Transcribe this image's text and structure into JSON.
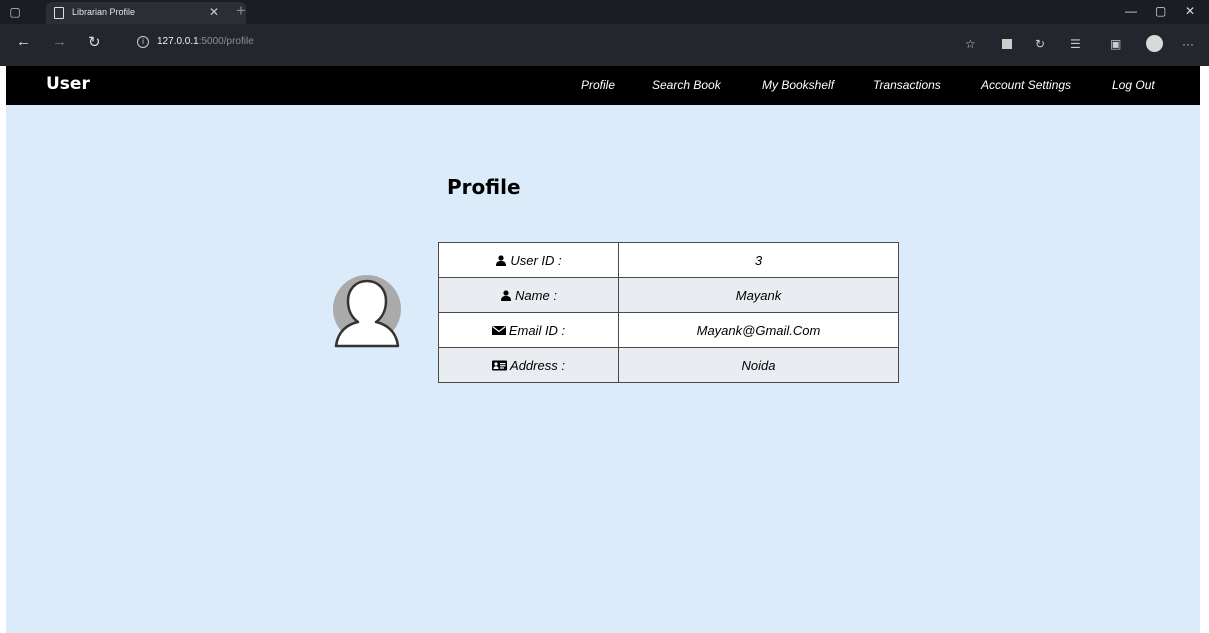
{
  "browser": {
    "tab_title": "Librarian Profile",
    "url_host": "127.0.0.1",
    "url_rest": ":5000/profile"
  },
  "navbar": {
    "brand": "User",
    "links": [
      "Profile",
      "Search Book",
      "My Bookshelf",
      "Transactions",
      "Account Settings",
      "Log Out"
    ]
  },
  "main": {
    "title": "Profile",
    "rows": [
      {
        "icon": "user-icon",
        "label": "User ID :",
        "value": "3"
      },
      {
        "icon": "user-icon",
        "label": "Name :",
        "value": "Mayank"
      },
      {
        "icon": "envelope-icon",
        "label": "Email ID :",
        "value": "Mayank@Gmail.Com"
      },
      {
        "icon": "address-card-icon",
        "label": "Address :",
        "value": "Noida"
      }
    ]
  },
  "colors": {
    "page_bg": "#dcebfa",
    "navbar_bg": "#000000",
    "row_alt_bg": "#e9edf1"
  }
}
